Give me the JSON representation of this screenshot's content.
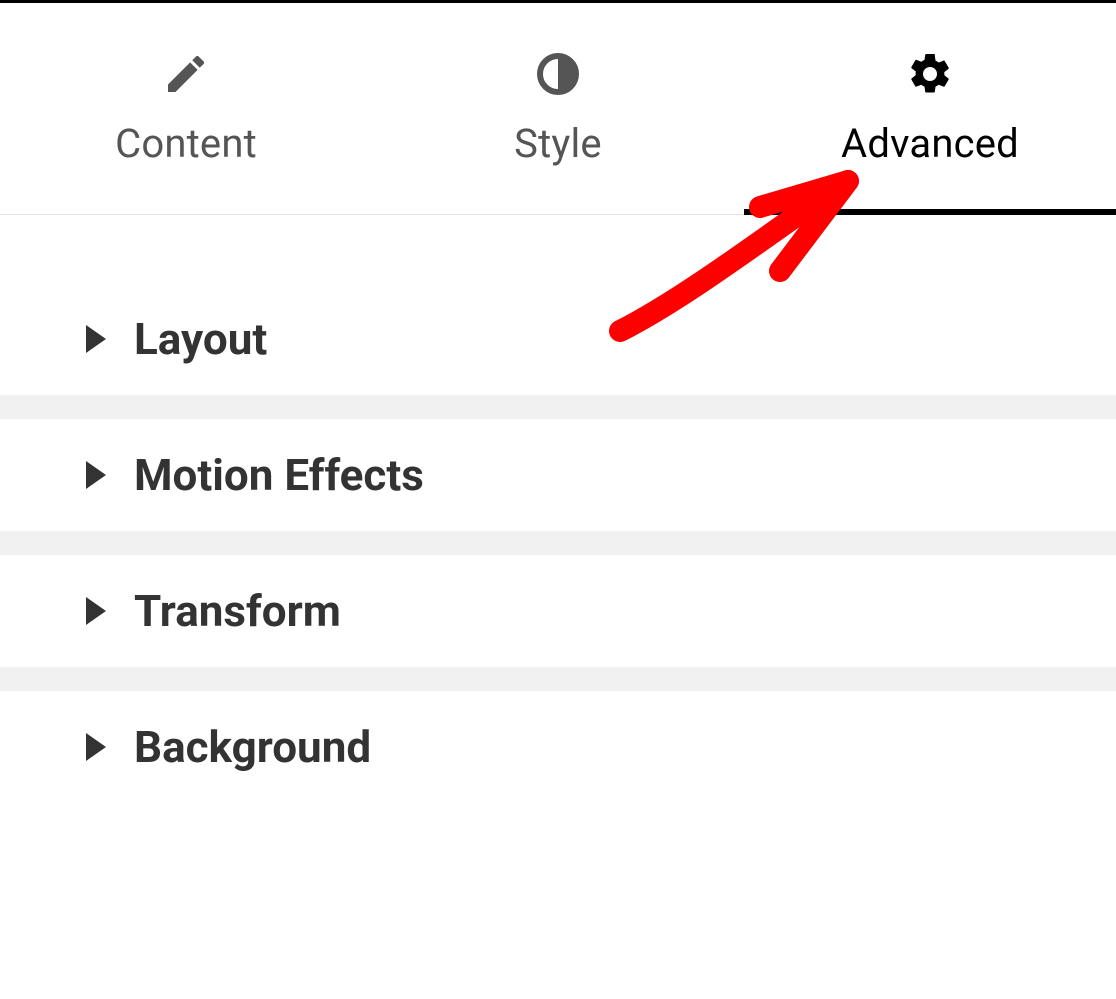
{
  "tabs": [
    {
      "id": "content",
      "label": "Content",
      "icon": "pencil",
      "active": false
    },
    {
      "id": "style",
      "label": "Style",
      "icon": "half-circle",
      "active": false
    },
    {
      "id": "advanced",
      "label": "Advanced",
      "icon": "gear",
      "active": true
    }
  ],
  "sections": [
    {
      "label": "Layout",
      "expanded": false
    },
    {
      "label": "Motion Effects",
      "expanded": false
    },
    {
      "label": "Transform",
      "expanded": false
    },
    {
      "label": "Background",
      "expanded": false
    }
  ],
  "annotation": {
    "type": "arrow",
    "color": "#ff0000",
    "points_to": "tab-advanced"
  }
}
